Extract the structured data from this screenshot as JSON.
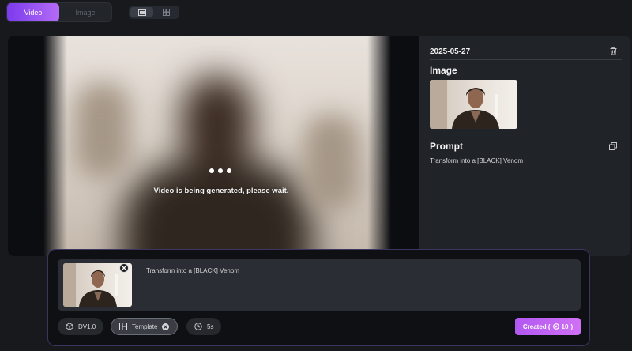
{
  "mode_tabs": [
    {
      "label": "Video",
      "active": true
    },
    {
      "label": "Image",
      "active": false
    }
  ],
  "layout_toggle": {
    "options": [
      "single-view-icon",
      "grid-view-icon"
    ],
    "active": 0
  },
  "preview": {
    "status_text": "Video is being generated, please wait."
  },
  "detail": {
    "date": "2025-05-27",
    "image_title": "Image",
    "prompt_title": "Prompt",
    "prompt_text": "Transform into a [BLACK] Venom"
  },
  "composer": {
    "input_text": "Transform into a [BLACK] Venom",
    "model_label": "DV1.0",
    "template_label": "Template",
    "duration_label": "5s",
    "create_label": "Created (",
    "create_cost": "10",
    "create_suffix": ")"
  },
  "colors": {
    "accent_start": "#7c3aed",
    "accent_end": "#b46cf5",
    "create_start": "#b258f2",
    "create_end": "#d070f5",
    "panel": "#202328",
    "background": "#17191d"
  }
}
